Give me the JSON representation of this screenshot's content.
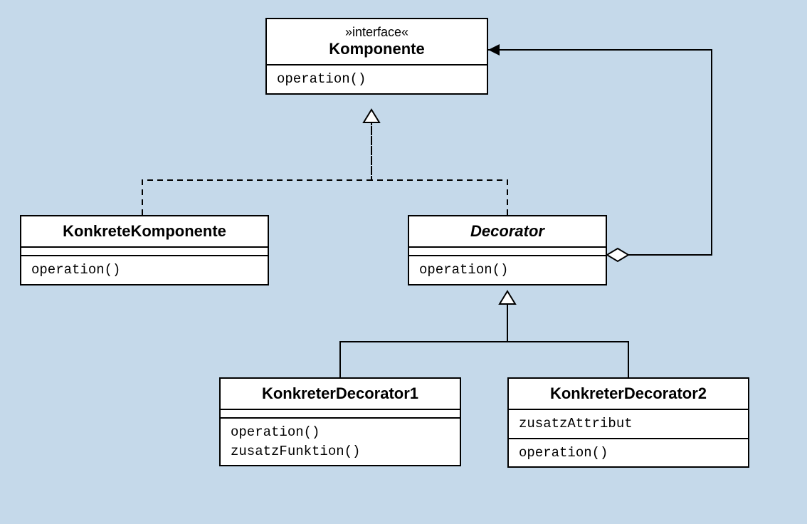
{
  "classes": {
    "komponente": {
      "stereotype": "»interface«",
      "name": "Komponente",
      "methods": [
        "operation()"
      ]
    },
    "konkreteKomponente": {
      "name": "KonkreteKomponente",
      "methods": [
        "operation()"
      ]
    },
    "decorator": {
      "name": "Decorator",
      "methods": [
        "operation()"
      ]
    },
    "konkreterDecorator1": {
      "name": "KonkreterDecorator1",
      "methods": [
        "operation()",
        "zusatzFunktion()"
      ]
    },
    "konkreterDecorator2": {
      "name": "KonkreterDecorator2",
      "attributes": [
        "zusatzAttribut"
      ],
      "methods": [
        "operation()"
      ]
    }
  }
}
